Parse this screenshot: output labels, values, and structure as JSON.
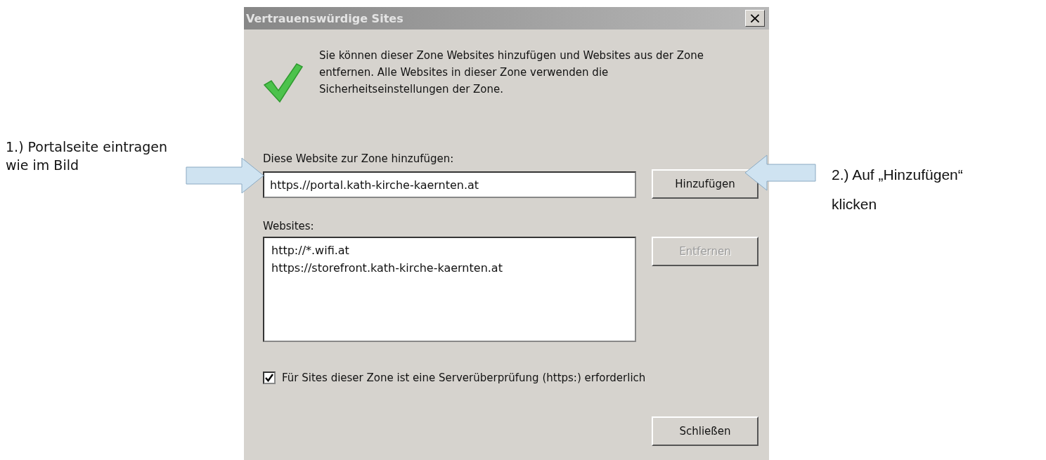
{
  "annotations": [
    {
      "kind": "left",
      "lines": [
        "1.) Portalseite eintragen",
        "wie im Bild"
      ]
    },
    {
      "kind": "right",
      "lines": [
        "2.) Auf „Hinzufügen“",
        "klicken"
      ]
    }
  ],
  "window": {
    "title": "Vertrauenswürdige Sites",
    "close": "×"
  },
  "description": "Sie können dieser Zone Websites hinzufügen und Websites aus der Zone entfernen. Alle Websites in dieser Zone verwenden die Sicherheitseinstellungen der Zone.",
  "add_label": "Diese Website zur Zone hinzufügen:",
  "add_field": {
    "value": "https.//portal.kath-kirche-kaernten.at"
  },
  "add_button": {
    "label": "Hinzufügen",
    "disabled": false
  },
  "websites_label": "Websites:",
  "websites": [
    {
      "label": "http://*.wifi.at",
      "selected": false
    },
    {
      "label": "https://storefront.kath-kirche-kaernten.at",
      "selected": false
    }
  ],
  "remove_button": {
    "label": "Entfernen",
    "disabled": true
  },
  "server_check": {
    "label": "Für Sites dieser Zone ist eine Serverüberprüfung (https:) erforderlich",
    "checked": true
  },
  "close_button": {
    "label": "Schließen",
    "disabled": false
  }
}
